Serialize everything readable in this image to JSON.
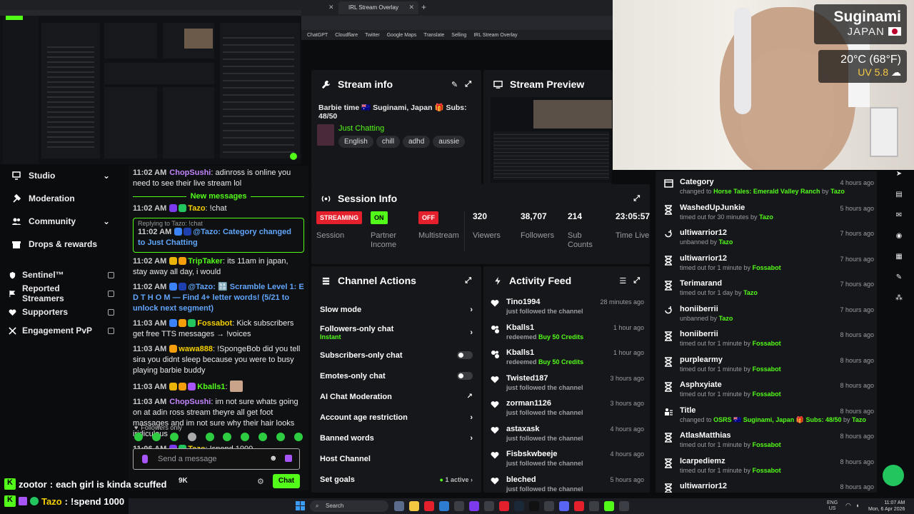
{
  "browser": {
    "tab_label": "IRL Stream Overlay",
    "bookmarks": [
      "ChatGPT",
      "Cloudflare",
      "Twitter",
      "Google Maps",
      "Translate",
      "Selling",
      "IRL Stream Overlay"
    ]
  },
  "nav": {
    "items": [
      {
        "label": "Studio",
        "chevron": true
      },
      {
        "label": "Moderation",
        "chevron": false
      },
      {
        "label": "Community",
        "chevron": true
      },
      {
        "label": "Drops & rewards",
        "chevron": false
      }
    ],
    "locked": [
      {
        "label": "Sentinel™"
      },
      {
        "label": "Reported Streamers"
      },
      {
        "label": "Supporters"
      },
      {
        "label": "Engagement PvP"
      }
    ]
  },
  "chat": {
    "new_messages": "New messages",
    "messages": [
      {
        "time": "11:02 AM",
        "user": "ChopSushi",
        "color": "#c084fc",
        "text": "adinross is online you need to see their live stream lol"
      },
      {
        "time": "11:02 AM",
        "user": "Tazo",
        "color": "#f5d000",
        "text": "!chat"
      },
      {
        "reply": "Replying to Tazo: !chat",
        "time": "11:02 AM",
        "user": "",
        "color": "#60a5fa",
        "text": "@Tazo: Category changed to Just Chatting"
      },
      {
        "time": "11:02 AM",
        "user": "TripTaker",
        "color": "#53fc18",
        "text": "its 11am in japan, stay away all day, i would"
      },
      {
        "time": "11:02 AM",
        "user": "",
        "color": "#60a5fa",
        "text": "@Tazo: 🔠 Scramble Level 1: E D T H O M — Find 4+ letter words! (5/21 to unlock next segment)"
      },
      {
        "time": "11:03 AM",
        "user": "Fossabot",
        "color": "#f5d000",
        "text": "Kick subscribers get free TTS messages → !voices"
      },
      {
        "time": "11:03 AM",
        "user": "wawa888",
        "color": "#f5d000",
        "text": "!SpongeBob did you tell sira you didnt sleep because you were to busy playing barbie buddy"
      },
      {
        "time": "11:03 AM",
        "user": "Kballs1",
        "color": "#53fc18",
        "text": ""
      },
      {
        "time": "11:03 AM",
        "user": "ChopSushi",
        "color": "#c084fc",
        "text": "im not sure whats going on at adin ross stream theyre all get foot massages and im not sure why their hair looks iridiculous"
      },
      {
        "time": "11:06 AM",
        "user": "Tazo",
        "color": "#f5d000",
        "text": "!spend 1000"
      }
    ],
    "followers_only": "Followers only",
    "placeholder": "Send a message",
    "count": "9K",
    "chat_button": "Chat"
  },
  "stream_info": {
    "header": "Stream info",
    "title": "Barbie time 🇦🇺 Suginami, Japan 🎁 Subs: 48/50",
    "category": "Just Chatting",
    "tags": [
      "English",
      "chill",
      "adhd",
      "aussie"
    ]
  },
  "stream_preview": {
    "header": "Stream Preview"
  },
  "session_info": {
    "header": "Session Info",
    "stats": [
      {
        "value": "STREAMING",
        "label": "Session",
        "pill": "#e5202d"
      },
      {
        "value": "ON",
        "label": "Partner Income",
        "pill": "#53fc18"
      },
      {
        "value": "OFF",
        "label": "Multistream",
        "pill": "#e5202d"
      },
      {
        "value": "320",
        "label": "Viewers"
      },
      {
        "value": "38,707",
        "label": "Followers"
      },
      {
        "value": "214",
        "label": "Sub Counts"
      },
      {
        "value": "23:05:57",
        "label": "Time Live"
      }
    ]
  },
  "channel_actions": {
    "header": "Channel Actions",
    "rows": [
      {
        "label": "Slow mode",
        "control": "chevron"
      },
      {
        "label": "Followers-only chat",
        "sub": "Instant",
        "control": "chevron"
      },
      {
        "label": "Subscribers-only chat",
        "control": "toggle"
      },
      {
        "label": "Emotes-only chat",
        "control": "toggle"
      },
      {
        "label": "AI Chat Moderation",
        "control": "external"
      },
      {
        "label": "Account age restriction",
        "control": "chevron"
      },
      {
        "label": "Banned words",
        "control": "chevron"
      },
      {
        "label": "Host Channel",
        "control": "none"
      },
      {
        "label": "Set goals",
        "sub_right": "1 active",
        "control": "chevron"
      }
    ]
  },
  "activity_feed": {
    "header": "Activity Feed",
    "items": [
      {
        "name": "Tino1994",
        "desc": "just followed the channel",
        "time": "28 minutes ago",
        "icon": "heart"
      },
      {
        "name": "Kballs1",
        "desc": "redeemed",
        "highlight": "Buy 50 Credits",
        "time": "1 hour ago",
        "icon": "redeem"
      },
      {
        "name": "Kballs1",
        "desc": "redeemed",
        "highlight": "Buy 50 Credits",
        "time": "1 hour ago",
        "icon": "redeem"
      },
      {
        "name": "Twisted187",
        "desc": "just followed the channel",
        "time": "3 hours ago",
        "icon": "heart"
      },
      {
        "name": "zorman1126",
        "desc": "just followed the channel",
        "time": "3 hours ago",
        "icon": "heart"
      },
      {
        "name": "astaxask",
        "desc": "just followed the channel",
        "time": "4 hours ago",
        "icon": "heart"
      },
      {
        "name": "Fisbskwbeeje",
        "desc": "just followed the channel",
        "time": "4 hours ago",
        "icon": "heart"
      },
      {
        "name": "bleched",
        "desc": "just followed the channel",
        "time": "5 hours ago",
        "icon": "heart"
      }
    ]
  },
  "mod_log": {
    "items": [
      {
        "name": "Category",
        "desc": "changed to",
        "target": "Horse Tales: Emerald Valley Ranch",
        "by": "Tazo",
        "time": "4 hours ago",
        "icon": "category"
      },
      {
        "name": "WashedUpJunkie",
        "desc": "timed out for 30 minutes by",
        "by": "Tazo",
        "time": "5 hours ago",
        "icon": "timeout"
      },
      {
        "name": "ultiwarrior12",
        "desc": "unbanned by",
        "by": "Tazo",
        "time": "7 hours ago",
        "icon": "unban"
      },
      {
        "name": "ultiwarrior12",
        "desc": "timed out for 1 minute by",
        "by": "Fossabot",
        "time": "7 hours ago",
        "icon": "timeout"
      },
      {
        "name": "Terimarand",
        "desc": "timed out for 1 day by",
        "by": "Tazo",
        "time": "7 hours ago",
        "icon": "timeout"
      },
      {
        "name": "honiiberrii",
        "desc": "unbanned by",
        "by": "Tazo",
        "time": "7 hours ago",
        "icon": "unban"
      },
      {
        "name": "honiiberrii",
        "desc": "timed out for 1 minute by",
        "by": "Fossabot",
        "time": "8 hours ago",
        "icon": "timeout"
      },
      {
        "name": "purplearmy",
        "desc": "timed out for 1 minute by",
        "by": "Fossabot",
        "time": "8 hours ago",
        "icon": "timeout"
      },
      {
        "name": "Asphxyiate",
        "desc": "timed out for 1 minute by",
        "by": "Fossabot",
        "time": "8 hours ago",
        "icon": "timeout"
      },
      {
        "name": "Title",
        "desc": "changed to",
        "target": "OSRS 🇦🇺 Suginami, Japan 🎁 Subs: 48/50",
        "by": "Tazo",
        "time": "8 hours ago",
        "icon": "title"
      },
      {
        "name": "AtlasMatthias",
        "desc": "timed out for 1 minute by",
        "by": "Fossabot",
        "time": "8 hours ago",
        "icon": "timeout"
      },
      {
        "name": "Icarpediemz",
        "desc": "timed out for 1 minute by",
        "by": "Fossabot",
        "time": "8 hours ago",
        "icon": "timeout"
      },
      {
        "name": "ultiwarrior12",
        "desc": "",
        "by": "",
        "time": "8 hours ago",
        "icon": "timeout"
      }
    ]
  },
  "overlay": {
    "location": "Suginami",
    "country": "JAPAN",
    "weather": "20°C (68°F)",
    "uv": "UV 5.8",
    "chat_line_1_user": "zootor",
    "chat_line_1_text": "each girl is kinda scuffed",
    "chat_line_2_user": "Tazo",
    "chat_line_2_text": "!spend 1000"
  },
  "taskbar": {
    "search": "Search",
    "lang": "ENG",
    "region": "US",
    "time": "11:07 AM",
    "date": "Mon, 6 Apr 2026"
  },
  "colors": {
    "accent": "#53fc18",
    "bg": "#0b0c0e",
    "panel": "#16171b",
    "live": "#e5202d"
  }
}
